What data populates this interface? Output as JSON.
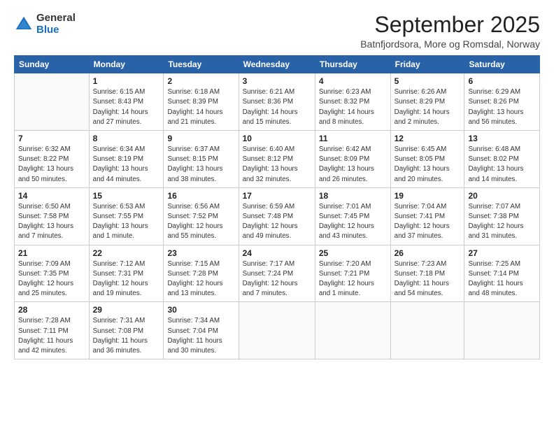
{
  "logo": {
    "general": "General",
    "blue": "Blue"
  },
  "title": "September 2025",
  "location": "Batnfjordsora, More og Romsdal, Norway",
  "weekdays": [
    "Sunday",
    "Monday",
    "Tuesday",
    "Wednesday",
    "Thursday",
    "Friday",
    "Saturday"
  ],
  "weeks": [
    [
      {
        "day": "",
        "info": ""
      },
      {
        "day": "1",
        "info": "Sunrise: 6:15 AM\nSunset: 8:43 PM\nDaylight: 14 hours\nand 27 minutes."
      },
      {
        "day": "2",
        "info": "Sunrise: 6:18 AM\nSunset: 8:39 PM\nDaylight: 14 hours\nand 21 minutes."
      },
      {
        "day": "3",
        "info": "Sunrise: 6:21 AM\nSunset: 8:36 PM\nDaylight: 14 hours\nand 15 minutes."
      },
      {
        "day": "4",
        "info": "Sunrise: 6:23 AM\nSunset: 8:32 PM\nDaylight: 14 hours\nand 8 minutes."
      },
      {
        "day": "5",
        "info": "Sunrise: 6:26 AM\nSunset: 8:29 PM\nDaylight: 14 hours\nand 2 minutes."
      },
      {
        "day": "6",
        "info": "Sunrise: 6:29 AM\nSunset: 8:26 PM\nDaylight: 13 hours\nand 56 minutes."
      }
    ],
    [
      {
        "day": "7",
        "info": "Sunrise: 6:32 AM\nSunset: 8:22 PM\nDaylight: 13 hours\nand 50 minutes."
      },
      {
        "day": "8",
        "info": "Sunrise: 6:34 AM\nSunset: 8:19 PM\nDaylight: 13 hours\nand 44 minutes."
      },
      {
        "day": "9",
        "info": "Sunrise: 6:37 AM\nSunset: 8:15 PM\nDaylight: 13 hours\nand 38 minutes."
      },
      {
        "day": "10",
        "info": "Sunrise: 6:40 AM\nSunset: 8:12 PM\nDaylight: 13 hours\nand 32 minutes."
      },
      {
        "day": "11",
        "info": "Sunrise: 6:42 AM\nSunset: 8:09 PM\nDaylight: 13 hours\nand 26 minutes."
      },
      {
        "day": "12",
        "info": "Sunrise: 6:45 AM\nSunset: 8:05 PM\nDaylight: 13 hours\nand 20 minutes."
      },
      {
        "day": "13",
        "info": "Sunrise: 6:48 AM\nSunset: 8:02 PM\nDaylight: 13 hours\nand 14 minutes."
      }
    ],
    [
      {
        "day": "14",
        "info": "Sunrise: 6:50 AM\nSunset: 7:58 PM\nDaylight: 13 hours\nand 7 minutes."
      },
      {
        "day": "15",
        "info": "Sunrise: 6:53 AM\nSunset: 7:55 PM\nDaylight: 13 hours\nand 1 minute."
      },
      {
        "day": "16",
        "info": "Sunrise: 6:56 AM\nSunset: 7:52 PM\nDaylight: 12 hours\nand 55 minutes."
      },
      {
        "day": "17",
        "info": "Sunrise: 6:59 AM\nSunset: 7:48 PM\nDaylight: 12 hours\nand 49 minutes."
      },
      {
        "day": "18",
        "info": "Sunrise: 7:01 AM\nSunset: 7:45 PM\nDaylight: 12 hours\nand 43 minutes."
      },
      {
        "day": "19",
        "info": "Sunrise: 7:04 AM\nSunset: 7:41 PM\nDaylight: 12 hours\nand 37 minutes."
      },
      {
        "day": "20",
        "info": "Sunrise: 7:07 AM\nSunset: 7:38 PM\nDaylight: 12 hours\nand 31 minutes."
      }
    ],
    [
      {
        "day": "21",
        "info": "Sunrise: 7:09 AM\nSunset: 7:35 PM\nDaylight: 12 hours\nand 25 minutes."
      },
      {
        "day": "22",
        "info": "Sunrise: 7:12 AM\nSunset: 7:31 PM\nDaylight: 12 hours\nand 19 minutes."
      },
      {
        "day": "23",
        "info": "Sunrise: 7:15 AM\nSunset: 7:28 PM\nDaylight: 12 hours\nand 13 minutes."
      },
      {
        "day": "24",
        "info": "Sunrise: 7:17 AM\nSunset: 7:24 PM\nDaylight: 12 hours\nand 7 minutes."
      },
      {
        "day": "25",
        "info": "Sunrise: 7:20 AM\nSunset: 7:21 PM\nDaylight: 12 hours\nand 1 minute."
      },
      {
        "day": "26",
        "info": "Sunrise: 7:23 AM\nSunset: 7:18 PM\nDaylight: 11 hours\nand 54 minutes."
      },
      {
        "day": "27",
        "info": "Sunrise: 7:25 AM\nSunset: 7:14 PM\nDaylight: 11 hours\nand 48 minutes."
      }
    ],
    [
      {
        "day": "28",
        "info": "Sunrise: 7:28 AM\nSunset: 7:11 PM\nDaylight: 11 hours\nand 42 minutes."
      },
      {
        "day": "29",
        "info": "Sunrise: 7:31 AM\nSunset: 7:08 PM\nDaylight: 11 hours\nand 36 minutes."
      },
      {
        "day": "30",
        "info": "Sunrise: 7:34 AM\nSunset: 7:04 PM\nDaylight: 11 hours\nand 30 minutes."
      },
      {
        "day": "",
        "info": ""
      },
      {
        "day": "",
        "info": ""
      },
      {
        "day": "",
        "info": ""
      },
      {
        "day": "",
        "info": ""
      }
    ]
  ]
}
